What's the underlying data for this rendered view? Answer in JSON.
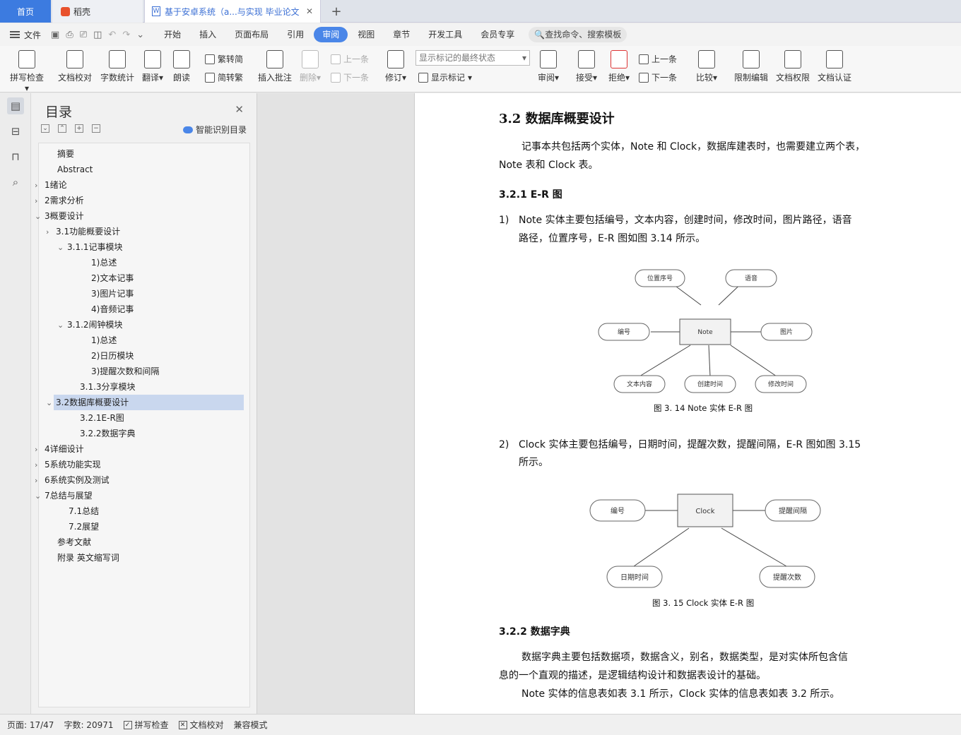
{
  "tabs": {
    "home": "首页",
    "daoke": "稻壳",
    "doc": "基于安卓系统（a...与实现 毕业论文"
  },
  "menu": {
    "file": "文件",
    "tabs": [
      "开始",
      "插入",
      "页面布局",
      "引用",
      "审阅",
      "视图",
      "章节",
      "开发工具",
      "会员专享"
    ],
    "active_tab": "审阅",
    "search": "查找命令、搜索模板"
  },
  "ribbon": {
    "spell": "拼写检查",
    "proof": "文档校对",
    "wordcount": "字数统计",
    "translate": "翻译",
    "read": "朗读",
    "t2s": "繁转简",
    "s2t": "简转繁",
    "insert_comment": "插入批注",
    "delete": "删除",
    "prev_comment": "上一条",
    "next_comment": "下一条",
    "revise": "修订",
    "markup_state": "显示标记的最终状态",
    "show_markup": "显示标记",
    "review": "审阅",
    "accept": "接受",
    "reject": "拒绝",
    "prev": "上一条",
    "next": "下一条",
    "compare": "比较",
    "restrict": "限制编辑",
    "permission": "文档权限",
    "certify": "文档认证"
  },
  "toc": {
    "title": "目录",
    "smart": "智能识别目录",
    "items": [
      "摘要",
      "Abstract",
      "1绪论",
      "2需求分析",
      "3概要设计",
      "3.1功能概要设计",
      "3.1.1记事模块",
      "1)总述",
      "2)文本记事",
      "3)图片记事",
      "4)音频记事",
      "3.1.2闹钟模块",
      "1)总述",
      "2)日历模块",
      "3)提醒次数和间隔",
      "3.1.3分享模块",
      "3.2数据库概要设计",
      "3.2.1E-R图",
      "3.2.2数据字典",
      "4详细设计",
      "5系统功能实现",
      "6系统实例及测试",
      "7总结与展望",
      "7.1总结",
      "7.2展望",
      "参考文献",
      "附录 英文缩写词"
    ]
  },
  "doc": {
    "h_32": "3.2 数据库概要设计",
    "p1a": "记事本共包括两个实体，Note 和 Clock，数据库建表时，也需要建立两个表，",
    "p1b": "Note 表和 Clock 表。",
    "h_321": "3.2.1 E-R 图",
    "l1n": "1)",
    "l1a": "Note 实体主要包括编号，文本内容，创建时间，修改时间，图片路径，语音",
    "l1b": "路径，位置序号，E-R 图如图 3.14 所示。",
    "er1": {
      "center": "Note",
      "nodes": [
        "位置序号",
        "语音",
        "编号",
        "图片",
        "文本内容",
        "创建时间",
        "修改时间"
      ]
    },
    "cap1": "图 3. 14 Note 实体 E-R 图",
    "l2n": "2)",
    "l2a": "Clock 实体主要包括编号，日期时间，提醒次数，提醒间隔，E-R 图如图 3.15",
    "l2b": "所示。",
    "er2": {
      "center": "Clock",
      "nodes": [
        "编号",
        "提醒间隔",
        "日期时间",
        "提醒次数"
      ]
    },
    "cap2": "图 3. 15 Clock 实体 E-R 图",
    "h_322": "3.2.2 数据字典",
    "p2a": "数据字典主要包括数据项，数据含义，别名，数据类型，是对实体所包含信",
    "p2b": "息的一个直观的描述，是逻辑结构设计和数据表设计的基础。",
    "p3": "Note 实体的信息表如表 3.1 所示，Clock 实体的信息表如表 3.2 所示。"
  },
  "status": {
    "page": "页面: 17/47",
    "words": "字数: 20971",
    "spell": "拼写检查",
    "proof": "文档校对",
    "compat": "兼容模式"
  }
}
